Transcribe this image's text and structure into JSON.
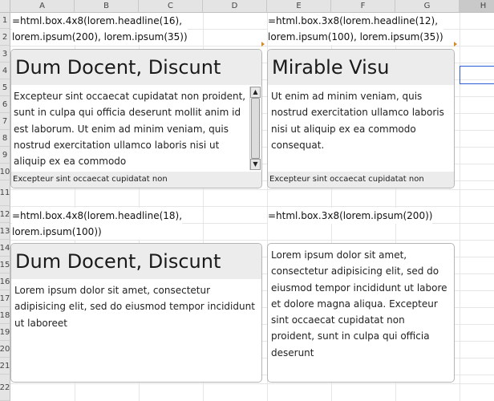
{
  "columns": [
    "A",
    "B",
    "C",
    "D",
    "E",
    "F",
    "G",
    "H"
  ],
  "rows": [
    "1",
    "2",
    "3",
    "4",
    "5",
    "6",
    "7",
    "8",
    "9",
    "10",
    "11",
    "12",
    "13",
    "14",
    "15",
    "16",
    "17",
    "18",
    "19",
    "20",
    "21",
    "22"
  ],
  "cells": {
    "a1_formula": "=html.box.4x8(lorem.headline(16),\nlorem.ipsum(200), lorem.ipsum(35))",
    "e1_formula": "=html.box.3x8(lorem.headline(12),\nlorem.ipsum(100), lorem.ipsum(35))",
    "a12_formula": "=html.box.4x8(lorem.headline(18),\nlorem.ipsum(100))",
    "e12_formula": "=html.box.3x8(lorem.ipsum(200))"
  },
  "boxes": {
    "box1": {
      "headline": "Dum Docent, Discunt",
      "body": "Excepteur sint occaecat cupidatat non proident, sunt in culpa qui officia deserunt mollit anim id est laborum. Ut enim ad minim veniam, quis nostrud exercitation ullamco laboris nisi ut aliquip ex ea commodo",
      "footer": "Excepteur sint occaecat cupidatat non"
    },
    "box2": {
      "headline": "Mirable Visu",
      "body": "Ut enim ad minim veniam, quis nostrud exercitation ullamco laboris nisi ut aliquip ex ea commodo consequat.",
      "footer": "Excepteur sint occaecat cupidatat non"
    },
    "box3": {
      "headline": "Dum Docent, Discunt",
      "body": "Lorem ipsum dolor sit amet, consectetur adipisicing elit, sed do eiusmod tempor incididunt ut laboreet"
    },
    "box4": {
      "body": "Lorem ipsum dolor sit amet, consectetur adipisicing elit, sed do eiusmod tempor incididunt ut labore et dolore magna aliqua. Excepteur sint occaecat cupidatat non proident, sunt in culpa qui officia deserunt"
    }
  },
  "scrollbar": {
    "up_glyph": "▲",
    "down_glyph": "▼"
  },
  "colors": {
    "header_bg": "#e4e4e4",
    "card_head_bg": "#ececec",
    "selection": "#2c5bd6",
    "overflow_arrow": "#d58b2b"
  }
}
